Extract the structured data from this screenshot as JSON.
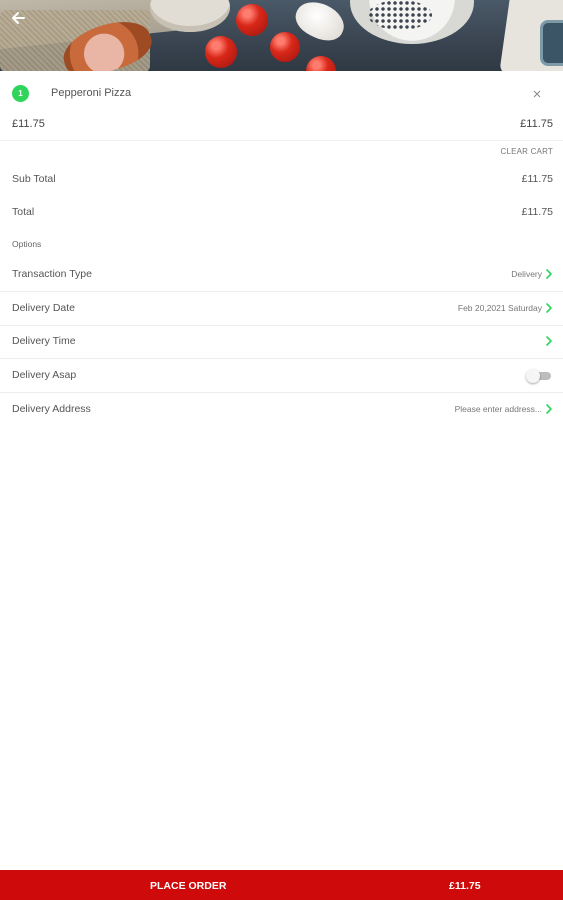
{
  "cart": {
    "items": [
      {
        "qty": "1",
        "name": "Pepperoni Pizza",
        "price": "£11.75",
        "line_total": "£11.75",
        "remove_icon": "close-icon"
      }
    ],
    "clear_label": "CLEAR CART"
  },
  "totals": {
    "subtotal_label": "Sub Total",
    "subtotal_value": "£11.75",
    "total_label": "Total",
    "total_value": "£11.75"
  },
  "options": {
    "header": "Options",
    "transaction_type": {
      "label": "Transaction Type",
      "value": "Delivery"
    },
    "delivery_date": {
      "label": "Delivery Date",
      "value": "Feb 20,2021 Saturday"
    },
    "delivery_time": {
      "label": "Delivery Time",
      "value": ""
    },
    "delivery_asap": {
      "label": "Delivery Asap",
      "enabled": false
    },
    "delivery_address": {
      "label": "Delivery Address",
      "value": "Please enter address..."
    }
  },
  "bottom_bar": {
    "action_label": "PLACE ORDER",
    "total": "£11.75"
  },
  "colors": {
    "accent_green": "#2fd55a",
    "action_red": "#cf0a0a"
  },
  "icons": {
    "back": "arrow-left-icon",
    "chevron": "chevron-right-icon"
  }
}
